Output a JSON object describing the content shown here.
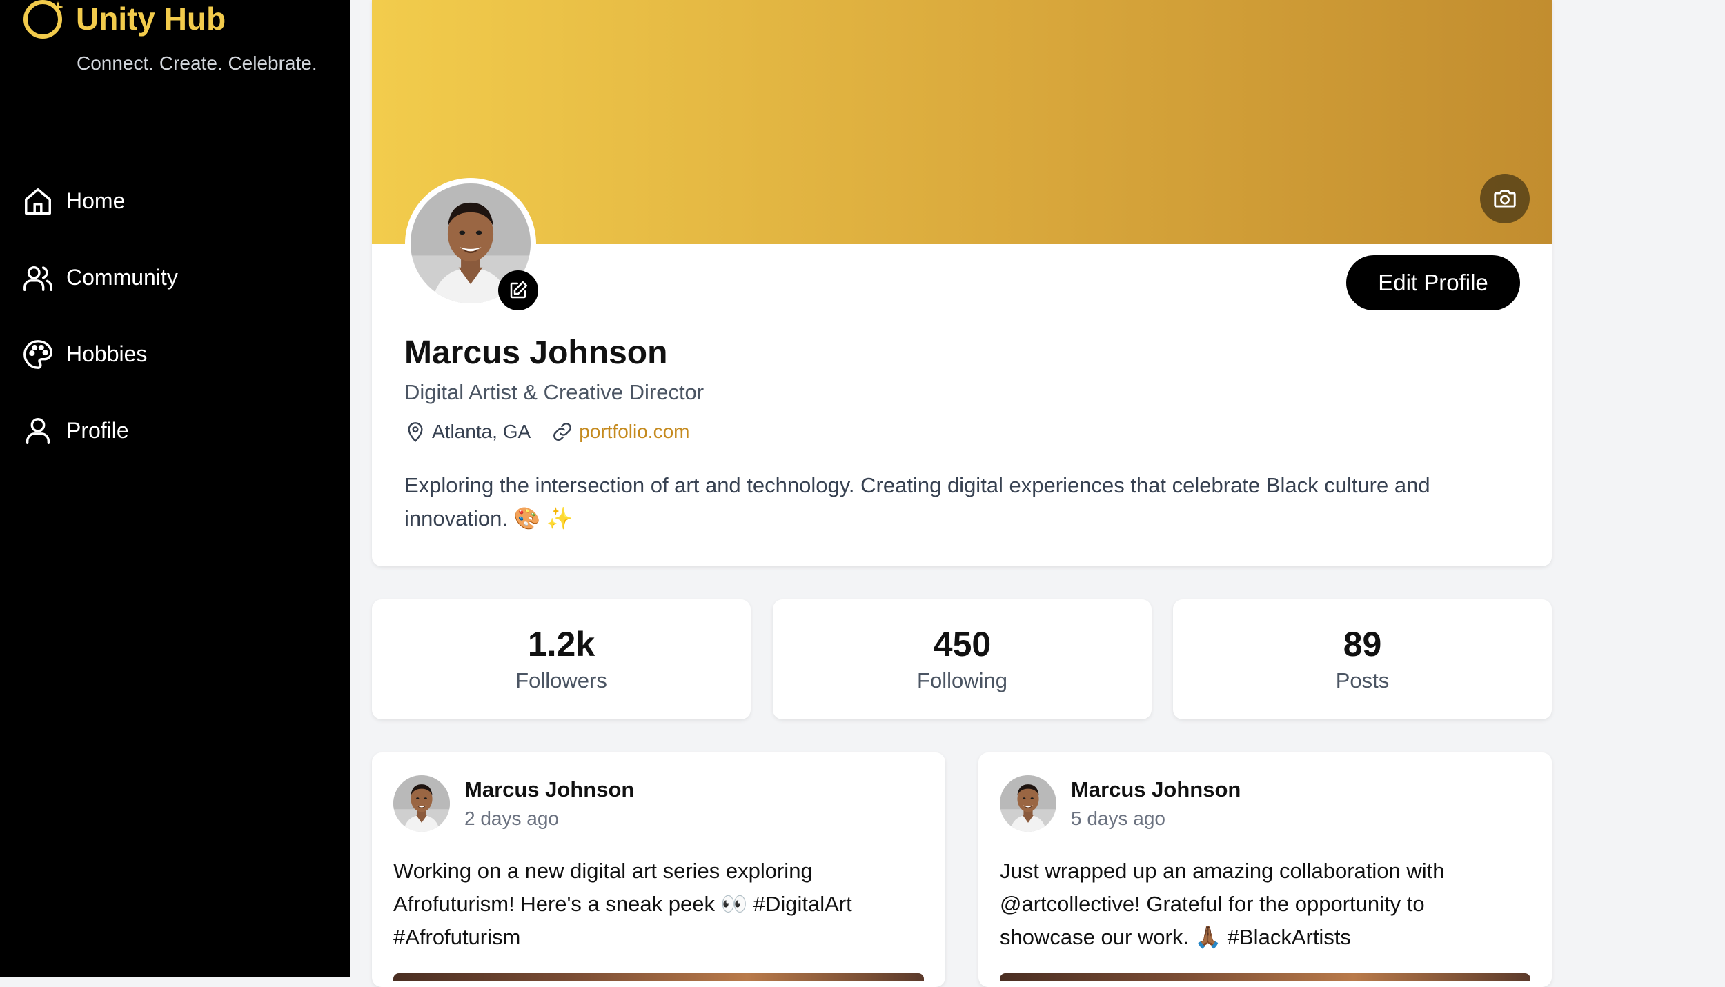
{
  "brand": {
    "name": "Unity Hub",
    "tagline": "Connect. Create. Celebrate.",
    "accent": "#f2cb4c"
  },
  "nav": [
    {
      "label": "Home",
      "icon": "home-icon"
    },
    {
      "label": "Community",
      "icon": "users-icon"
    },
    {
      "label": "Hobbies",
      "icon": "palette-icon"
    },
    {
      "label": "Profile",
      "icon": "user-icon"
    }
  ],
  "profile": {
    "name": "Marcus Johnson",
    "title": "Digital Artist & Creative Director",
    "location": "Atlanta, GA",
    "website": "portfolio.com",
    "bio": "Exploring the intersection of art and technology. Creating digital experiences that celebrate Black culture and innovation. 🎨 ✨",
    "edit_label": "Edit Profile"
  },
  "stats": [
    {
      "value": "1.2k",
      "label": "Followers"
    },
    {
      "value": "450",
      "label": "Following"
    },
    {
      "value": "89",
      "label": "Posts"
    }
  ],
  "posts": [
    {
      "author": "Marcus Johnson",
      "time": "2 days ago",
      "text": "Working on a new digital art series exploring Afrofuturism! Here's a sneak peek 👀 #DigitalArt #Afrofuturism"
    },
    {
      "author": "Marcus Johnson",
      "time": "5 days ago",
      "text": "Just wrapped up an amazing collaboration with @artcollective! Grateful for the opportunity to showcase our work. 🙏🏾 #BlackArtists"
    }
  ]
}
